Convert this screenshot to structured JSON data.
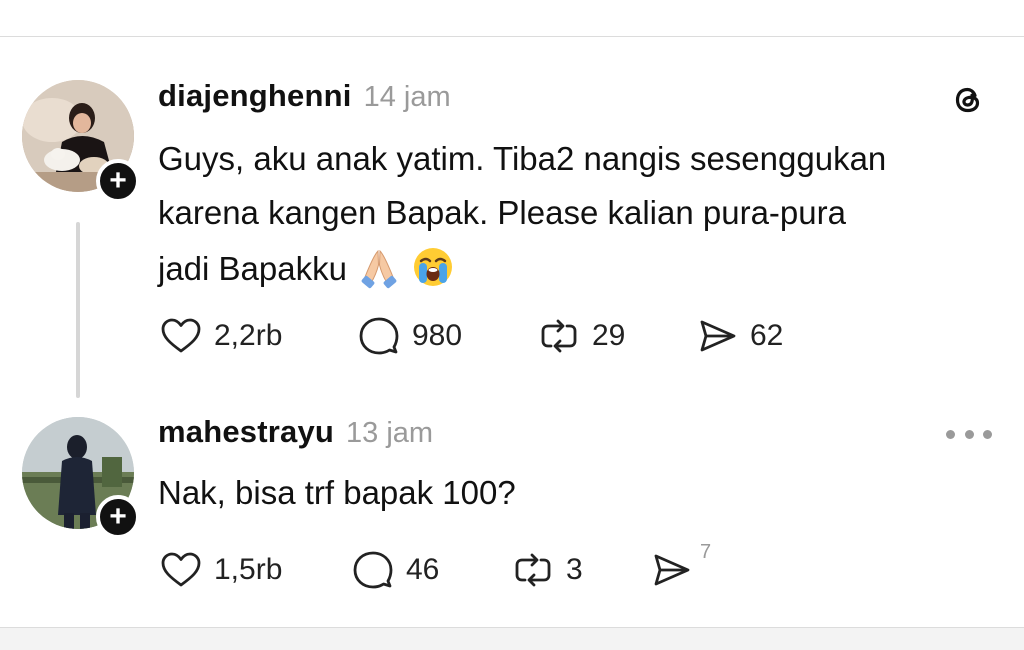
{
  "posts": [
    {
      "username": "diajenghenni",
      "time": "14 jam",
      "text_lines": [
        "Guys, aku anak yatim. Tiba2 nangis sesenggukan",
        "karena kangen Bapak. Please kalian pura-pura",
        "jadi Bapakku"
      ],
      "emojis": [
        "folded-hands-emoji",
        "loudly-crying-face-emoji"
      ],
      "header_icon": "threads-logo-icon",
      "stats": {
        "likes": "2,2rb",
        "comments": "980",
        "reposts": "29",
        "shares": "62"
      }
    },
    {
      "username": "mahestrayu",
      "time": "13 jam",
      "text_lines": [
        "Nak, bisa trf bapak 100?"
      ],
      "header_icon": "more-options-icon",
      "stats": {
        "likes": "1,5rb",
        "comments": "46",
        "reposts": "3",
        "shares": "7"
      }
    }
  ],
  "icons": {
    "follow": "plus-icon",
    "like": "heart-icon",
    "comment": "comment-bubble-icon",
    "repost": "repost-icon",
    "share": "send-icon"
  },
  "colors": {
    "text": "#111111",
    "muted": "#9a9a9a",
    "divider": "#dcdcdc",
    "thread_line": "#d6d6d6"
  }
}
